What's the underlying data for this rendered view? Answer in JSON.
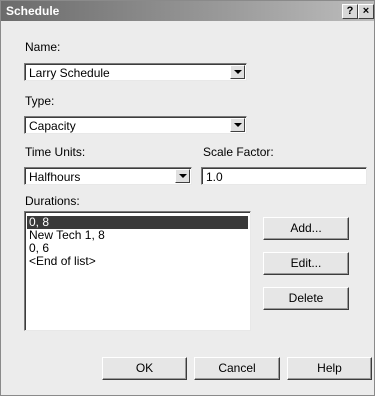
{
  "window": {
    "title": "Schedule",
    "help_label": "?",
    "close_label": "×"
  },
  "form": {
    "name_label": "Name:",
    "name_value": "Larry Schedule",
    "type_label": "Type:",
    "type_value": "Capacity",
    "time_units_label": "Time Units:",
    "time_units_value": "Halfhours",
    "scale_factor_label": "Scale Factor:",
    "scale_factor_value": "1.0",
    "durations_label": "Durations:"
  },
  "durations": {
    "items": [
      "0, 8",
      "New Tech 1, 8",
      "0, 6",
      "<End of list>"
    ],
    "selected_index": 0
  },
  "side_buttons": {
    "add": "Add...",
    "edit": "Edit...",
    "delete": "Delete"
  },
  "footer_buttons": {
    "ok": "OK",
    "cancel": "Cancel",
    "help": "Help"
  }
}
